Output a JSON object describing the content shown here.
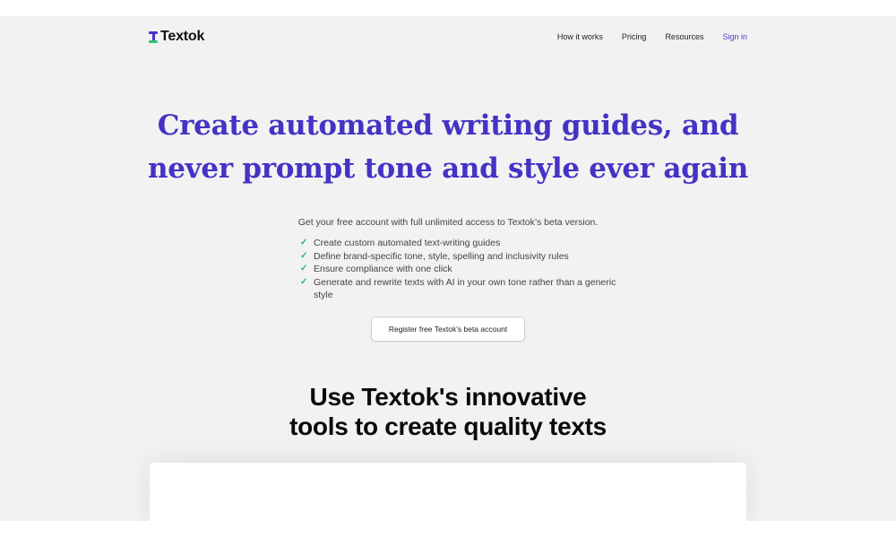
{
  "brand": {
    "name": "Textok",
    "logo_colors": {
      "primary": "#4433cc",
      "accent": "#2fc46b"
    }
  },
  "nav": {
    "items": [
      {
        "label": "How it works"
      },
      {
        "label": "Pricing"
      },
      {
        "label": "Resources"
      },
      {
        "label": "Sign in"
      }
    ]
  },
  "hero": {
    "title_line1": "Create automated writing guides, and",
    "title_line2": "never prompt tone and style ever again",
    "subtitle": "Get your free account with full unlimited access to Textok’s beta version.",
    "features": [
      "Create custom automated text-writing guides",
      "Define brand-specific tone, style, spelling and inclusivity rules",
      "Ensure compliance with one click",
      "Generate and rewrite texts with AI in your own tone rather than a generic style"
    ],
    "cta_label": "Register free Textok's beta account"
  },
  "section": {
    "title_line1": "Use Textok's innovative",
    "title_line2": "tools to create quality texts"
  },
  "colors": {
    "title": "#4433c4",
    "check": "#2fb85f",
    "link": "#4a3fc9",
    "background": "#f2f2f2"
  }
}
